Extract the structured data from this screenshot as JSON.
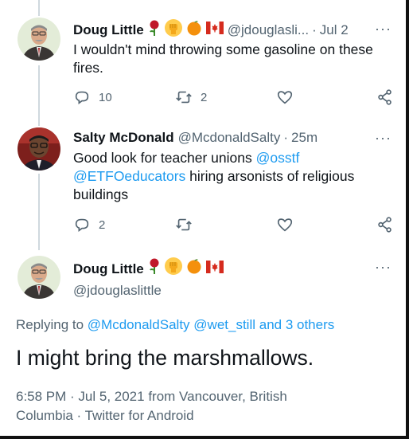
{
  "tweets": [
    {
      "name": "Doug Little",
      "emojis": [
        "rose",
        "raised-fist",
        "orange",
        "canada-flag"
      ],
      "handle": "@jdouglasli...",
      "separator": "·",
      "time": "Jul 2",
      "more": "···",
      "text": "I wouldn't mind throwing some gasoline on these fires.",
      "reply_count": "10",
      "retweet_count": "2",
      "like_count": "",
      "avatar_bg": "#e3ecd8"
    },
    {
      "name": "Salty McDonald",
      "handle": "@McdonaldSalty",
      "separator": "·",
      "time": "25m",
      "more": "···",
      "text_parts": {
        "intro": "Good look for teacher unions ",
        "mention1": "@osstf",
        "mention2": "@ETFOeducators",
        "rest": " hiring arsonists of religious buildings"
      },
      "reply_count": "2",
      "retweet_count": "",
      "like_count": ""
    }
  ],
  "main_tweet": {
    "name": "Doug Little",
    "emojis": [
      "rose",
      "raised-fist",
      "orange",
      "canada-flag"
    ],
    "handle": "@jdouglaslittle",
    "more": "···",
    "replying_label": "Replying to ",
    "replying_mention1": "@McdonaldSalty",
    "replying_space": " ",
    "replying_mention2": "@wet_still",
    "replying_tail": " and 3 others",
    "text": "I might bring the marshmallows.",
    "meta": "6:58 PM · Jul 5, 2021 from Vancouver, British Columbia · Twitter for Android"
  },
  "colors": {
    "link": "#1d9bf0",
    "muted": "#536471",
    "text": "#0f1419",
    "thread_line": "#cfd9de"
  }
}
